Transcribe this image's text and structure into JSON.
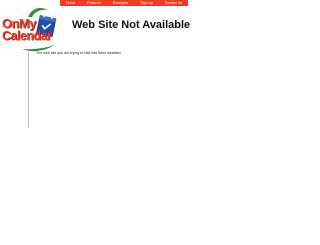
{
  "nav": {
    "items": [
      {
        "label": "Home"
      },
      {
        "label": "Features"
      },
      {
        "label": "Examples"
      },
      {
        "label": "Sign Up"
      },
      {
        "label": "Contact Us"
      }
    ]
  },
  "logo": {
    "line1": "OnMy",
    "line2": "Calendar"
  },
  "page": {
    "title": "Web Site Not Available",
    "message": "The web site you are trying to visit has been disabled."
  },
  "colors": {
    "accent": "#ee3b24",
    "logo_green": "#2f8f3a",
    "logo_blue": "#1f4fa8"
  }
}
